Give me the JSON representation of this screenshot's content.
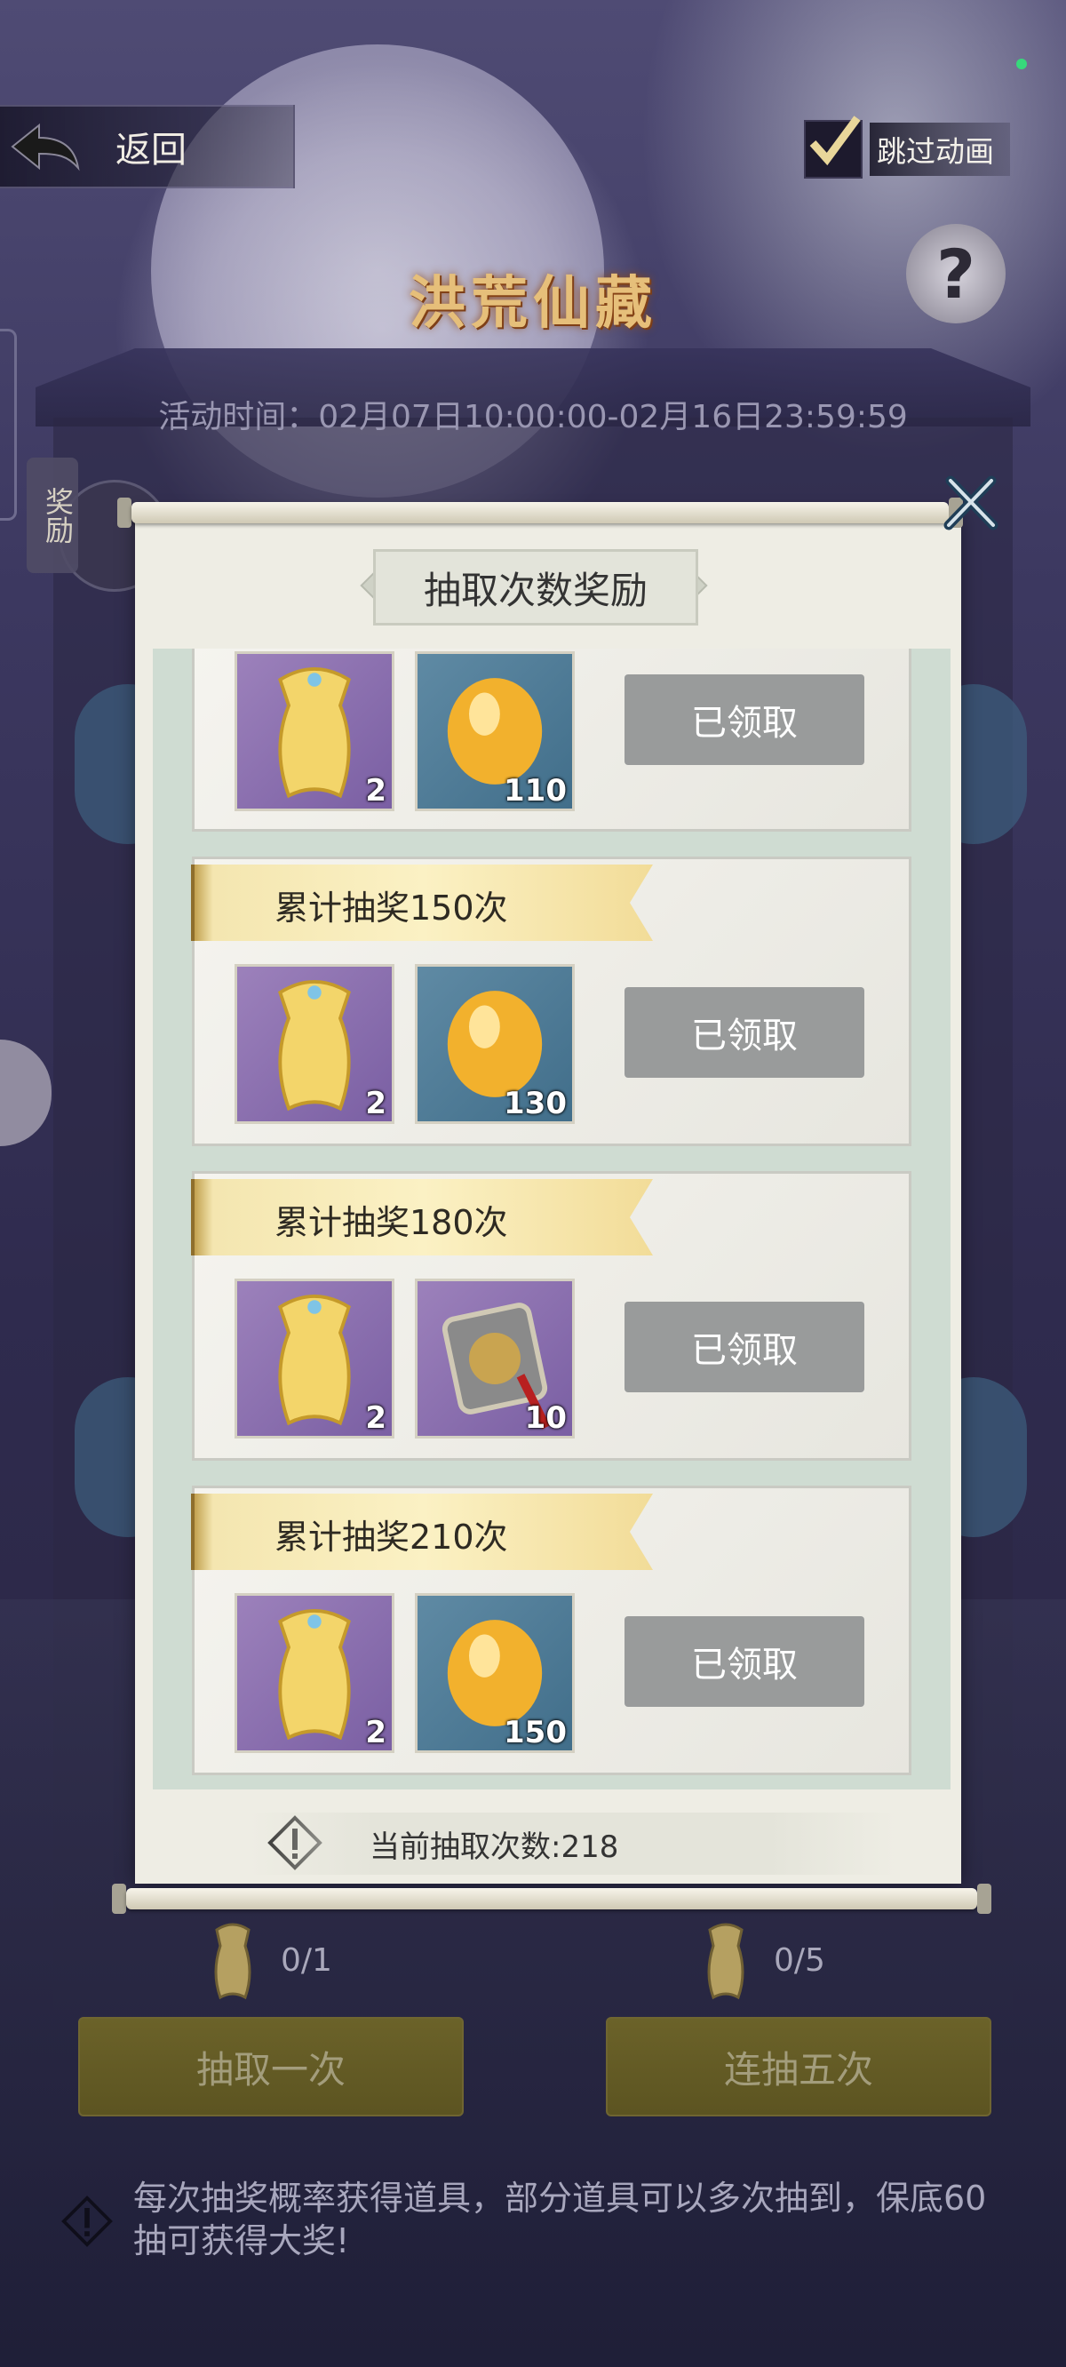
{
  "header": {
    "back_label": "返回",
    "skip_label": "跳过动画",
    "help_symbol": "?",
    "event_title": "洪荒仙藏",
    "event_time": "活动时间：02月07日10:00:00-02月16日23:59:59",
    "reward_tab_label": "奖励"
  },
  "dialog": {
    "title": "抽取次数奖励",
    "cards": [
      {
        "milestone": "",
        "items": [
          {
            "icon": "golden-talisman-icon",
            "count": "2"
          },
          {
            "icon": "gold-ingot-icon",
            "count": "110"
          }
        ],
        "button": "已领取"
      },
      {
        "milestone": "累计抽奖150次",
        "items": [
          {
            "icon": "golden-talisman-icon",
            "count": "2"
          },
          {
            "icon": "gold-ingot-icon",
            "count": "130"
          }
        ],
        "button": "已领取"
      },
      {
        "milestone": "累计抽奖180次",
        "items": [
          {
            "icon": "golden-talisman-icon",
            "count": "2"
          },
          {
            "icon": "jade-pendant-icon",
            "count": "10"
          }
        ],
        "button": "已领取"
      },
      {
        "milestone": "累计抽奖210次",
        "items": [
          {
            "icon": "golden-talisman-icon",
            "count": "2"
          },
          {
            "icon": "gold-ingot-icon",
            "count": "150"
          }
        ],
        "button": "已领取"
      }
    ],
    "current_draws": "当前抽取次数:218"
  },
  "draw": {
    "single_cost": "0/1",
    "single_label": "抽取一次",
    "five_cost": "0/5",
    "five_label": "连抽五次"
  },
  "notice": "每次抽奖概率获得道具，部分道具可以多次抽到，保底60抽可获得大奖!",
  "colors": {
    "banner_gold": "#f4e6b0",
    "claimed_gray": "#999b9b",
    "draw_button_olive": "#6b6229",
    "item_purple": "#8a6fb0",
    "item_blue": "#4f7b96"
  }
}
